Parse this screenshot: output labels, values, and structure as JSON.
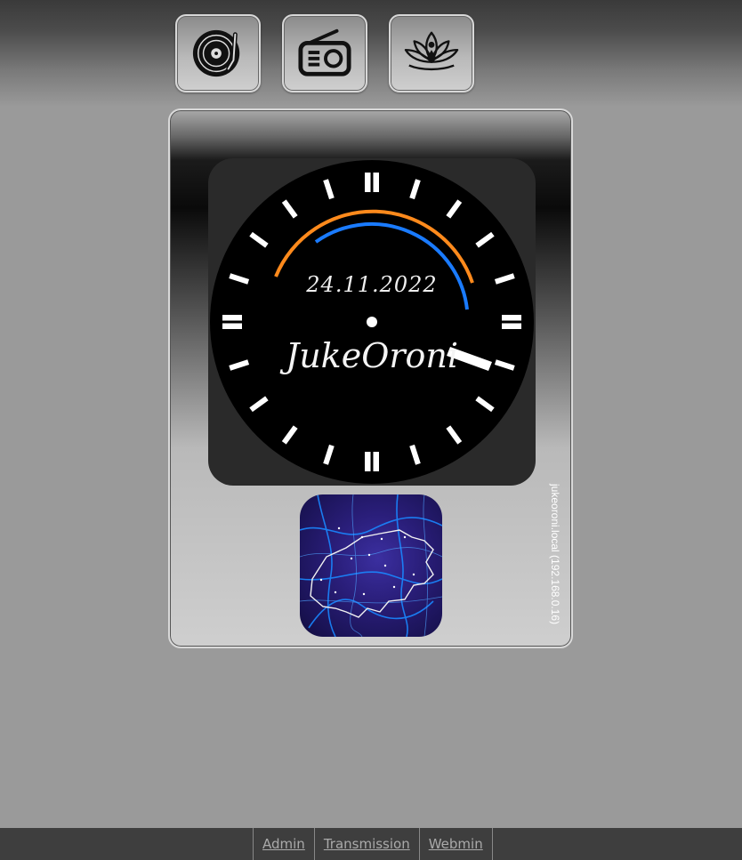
{
  "nav": {
    "buttons": [
      {
        "name": "vinyl-record-icon"
      },
      {
        "name": "radio-icon"
      },
      {
        "name": "lotus-meditation-icon"
      }
    ]
  },
  "clock": {
    "date": "24.11.2022",
    "brand": "JukeOroni"
  },
  "host_label": "jukeoroni.local (192.168.0.16)",
  "footer": {
    "links": [
      "Admin",
      "Transmission",
      "Webmin"
    ]
  },
  "colors": {
    "arc_outer": "#ff8a1c",
    "arc_inner": "#1a7bff",
    "clock_face": "#000000",
    "footer_bg": "#3e3e3e",
    "map_tile": "#2a1e7a"
  }
}
